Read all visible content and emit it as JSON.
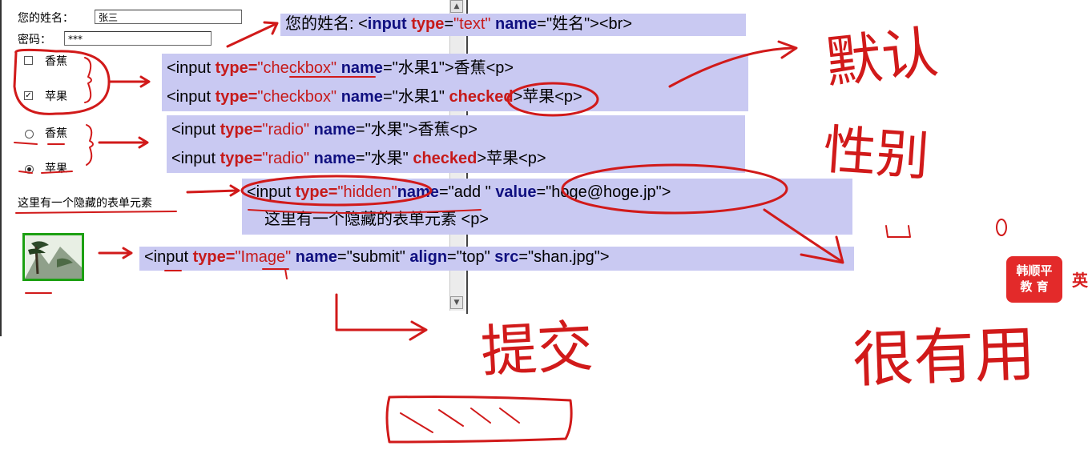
{
  "form": {
    "name_label": "您的姓名：",
    "name_value": "张三",
    "password_label": "密码：",
    "password_value": "***",
    "checkbox1_label": "香蕉",
    "checkbox2_label": "苹果",
    "checkbox2_checked": true,
    "radio1_label": "香蕉",
    "radio2_label": "苹果",
    "radio2_checked": true,
    "hidden_note": "这里有一个隐藏的表单元素"
  },
  "code": {
    "line1_prefix": "您的姓名: <",
    "line1_tag": "input",
    "line1_type_attr": "type",
    "line1_type_val": "\"text\"",
    "line1_name_attr": "name",
    "line1_name_val": "=\"姓名\"><br>",
    "cb1_open": "<input ",
    "cb1_type_attr": "type=",
    "cb1_type_val": "\"checkbox\"",
    "cb1_name_attr": "name",
    "cb1_rest": "=\"水果1\">香蕉<p>",
    "cb2_open": "<input ",
    "cb2_type_attr": "type=",
    "cb2_type_val": "\"checkbox\"",
    "cb2_name_attr": "name",
    "cb2_mid": "=\"水果1\" ",
    "cb2_checked": "checked",
    "cb2_rest": ">苹果<p>",
    "rb1_open": "<input ",
    "rb1_type_attr": "type=",
    "rb1_type_val": "\"radio\"",
    "rb1_name_attr": "name",
    "rb1_rest": "=\"水果\">香蕉<p>",
    "rb2_open": "<input ",
    "rb2_type_attr": "type=",
    "rb2_type_val": "\"radio\"",
    "rb2_name_attr": "name",
    "rb2_mid": "=\"水果\" ",
    "rb2_checked": "checked",
    "rb2_rest": ">苹果<p>",
    "hid_open": "<input ",
    "hid_type_attr": "type=",
    "hid_type_val": "\"hidden\"",
    "hid_name_attr": "name",
    "hid_mid": "=\"add \" ",
    "hid_value_attr": "value",
    "hid_value_val": "=\"hoge@hoge.jp\">",
    "hid_note": "这里有一个隐藏的表单元素 <p>",
    "img_open": "<input ",
    "img_type_attr": "type=",
    "img_type_val": "\"Image\"",
    "img_name_attr": "name",
    "img_name_val": "=\"submit\" ",
    "img_align_attr": "align",
    "img_align_val": "=\"top\" ",
    "img_src_attr": "src",
    "img_src_val": "=\"shan.jpg\">"
  },
  "annotations": {
    "note_default": "默认",
    "note_gender": "性别",
    "note_submit": "提交",
    "note_useful": "很有用"
  },
  "logo": {
    "line1": "韩顺平",
    "line2": "教 育",
    "side": "英"
  },
  "colors": {
    "code_bg": "#c9c9f2",
    "keyword": "#101080",
    "string": "#c61a1a",
    "ink": "#d11a1a",
    "thumb_border": "#1ca012"
  }
}
